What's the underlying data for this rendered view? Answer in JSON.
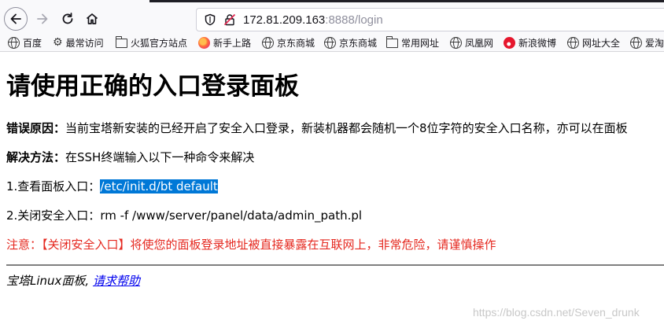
{
  "browser": {
    "url_host": "172.81.209.163",
    "url_rest": ":8888/login",
    "bookmarks": [
      {
        "label": "百度",
        "icon": "globe-icon"
      },
      {
        "label": "最常访问",
        "icon": "gear-icon"
      },
      {
        "label": "火狐官方站点",
        "icon": "folder-icon"
      },
      {
        "label": "新手上路",
        "icon": "firefox-icon"
      },
      {
        "label": "京东商城",
        "icon": "globe-icon"
      },
      {
        "label": "京东商城",
        "icon": "globe-icon"
      },
      {
        "label": "常用网址",
        "icon": "folder-icon"
      },
      {
        "label": "凤凰网",
        "icon": "globe-icon"
      },
      {
        "label": "新浪微博",
        "icon": "weibo-icon"
      },
      {
        "label": "网址大全",
        "icon": "globe-icon"
      },
      {
        "label": "爱淘",
        "icon": "globe-icon"
      }
    ]
  },
  "page": {
    "title": "请使用正确的入口登录面板",
    "error_label": "错误原因：",
    "error_text": "当前宝塔新安装的已经开启了安全入口登录，新装机器都会随机一个8位字符的安全入口名称，亦可以在面板",
    "solution_label": "解决方法：",
    "solution_text": "在SSH终端输入以下一种命令来解决",
    "step1_label": "1.查看面板入口：",
    "step1_cmd": "/etc/init.d/bt default",
    "step2_label": "2.关闭安全入口：",
    "step2_cmd": "rm -f /www/server/panel/data/admin_path.pl",
    "warning": "注意：【关闭安全入口】将使您的面板登录地址被直接暴露在互联网上，非常危险，请谨慎操作",
    "footer_text": "宝塔Linux面板, ",
    "footer_link": "请求帮助"
  },
  "watermark": "https://blog.csdn.net/Seven_drunk",
  "colors": {
    "warning": "#e5281f",
    "selection": "#0078d7",
    "link": "#0000ee"
  }
}
